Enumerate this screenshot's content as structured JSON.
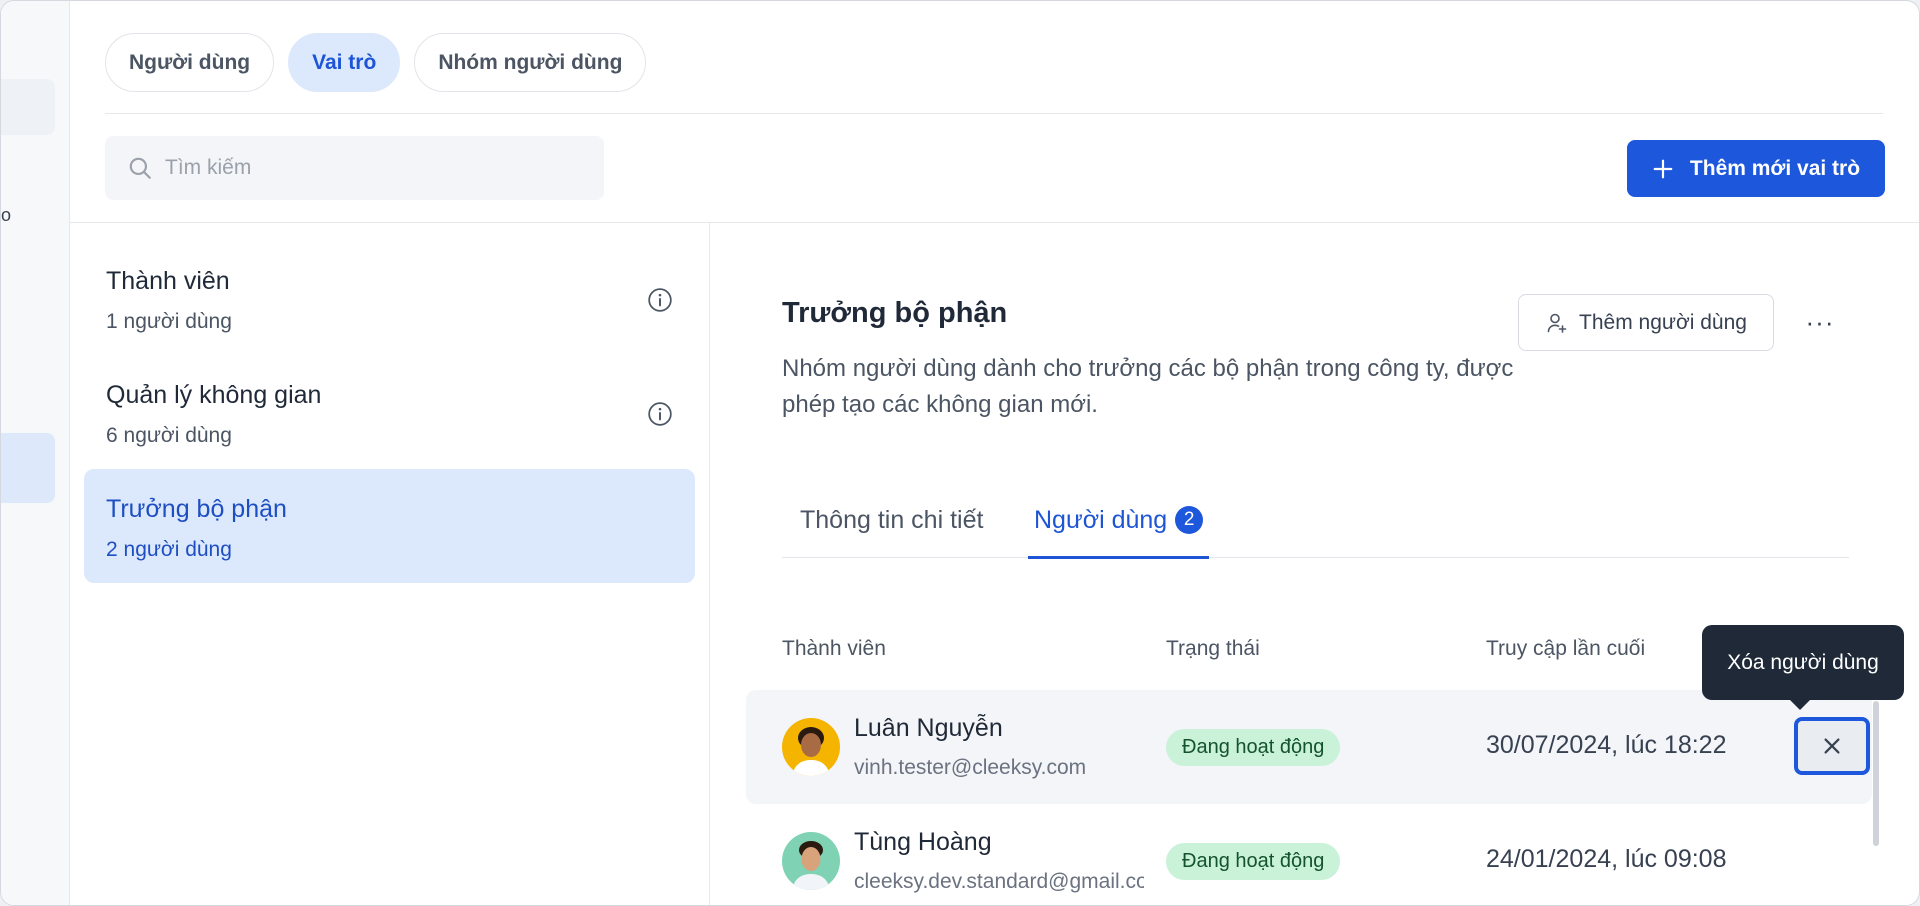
{
  "rail": {
    "glyph": "o"
  },
  "tabs": [
    {
      "label": "Người dùng",
      "active": false
    },
    {
      "label": "Vai trò",
      "active": true
    },
    {
      "label": "Nhóm người dùng",
      "active": false
    }
  ],
  "search": {
    "placeholder": "Tìm kiếm",
    "value": ""
  },
  "add_role_button": {
    "label": "Thêm mới vai trò"
  },
  "roles": [
    {
      "name": "Thành viên",
      "count": "1 người dùng",
      "active": false,
      "info": true
    },
    {
      "name": "Quản lý không gian",
      "count": "6 người dùng",
      "active": false,
      "info": true
    },
    {
      "name": "Trưởng bộ phận",
      "count": "2 người dùng",
      "active": true,
      "info": false
    }
  ],
  "detail": {
    "title": "Trưởng bộ phận",
    "description": "Nhóm người dùng dành cho trưởng các bộ phận trong công ty, được phép tạo các không gian mới.",
    "add_user_label": "Thêm người dùng",
    "more_label": "···",
    "tabs": [
      {
        "label": "Thông tin chi tiết"
      },
      {
        "label": "Người dùng",
        "badge": "2"
      }
    ],
    "table": {
      "headers": [
        "Thành viên",
        "Trạng thái",
        "Truy cập lần cuối"
      ],
      "rows": [
        {
          "name": "Luân Nguyễn",
          "email": "vinh.tester@cleeksy.com",
          "status": "Đang hoạt động",
          "last_access": "30/07/2024, lúc 18:22"
        },
        {
          "name": "Tùng Hoàng",
          "email": "cleeksy.dev.standard@gmail.com",
          "status": "Đang hoạt động",
          "last_access": "24/01/2024, lúc 09:08"
        }
      ]
    },
    "remove_tooltip": "Xóa người dùng"
  },
  "colors": {
    "primary": "#1c57dc",
    "active_bg": "#dce8fb",
    "status_bg": "#c9f2d9"
  },
  "icons": [
    "search-icon",
    "plus-icon",
    "info-icon",
    "user-plus-icon",
    "more-icon",
    "close-icon"
  ]
}
